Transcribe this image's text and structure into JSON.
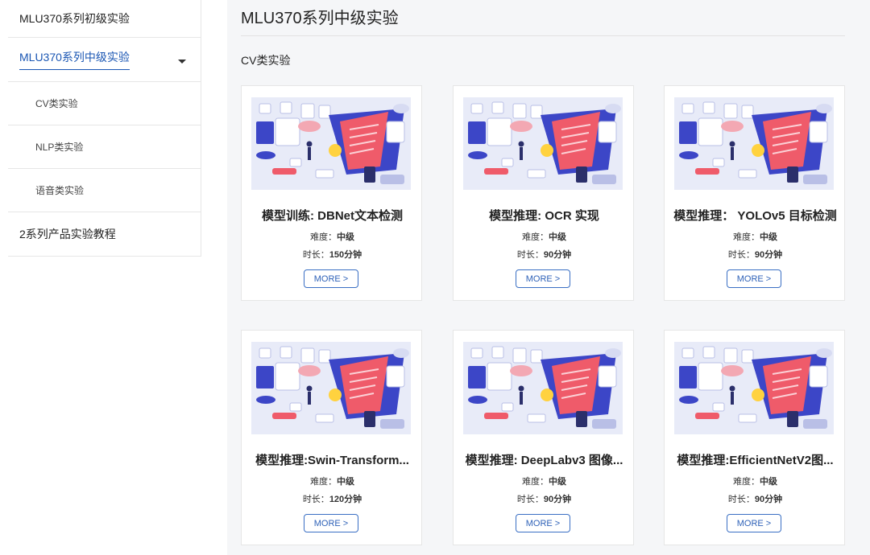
{
  "sidebar": {
    "items": [
      {
        "label": "MLU370系列初级实验"
      },
      {
        "label": "MLU370系列中级实验"
      },
      {
        "label": "2系列产品实验教程"
      }
    ],
    "sub_items": [
      {
        "label": "CV类实验"
      },
      {
        "label": "NLP类实验"
      },
      {
        "label": "语音类实验"
      }
    ]
  },
  "main": {
    "title": "MLU370系列中级实验",
    "section": "CV类实验",
    "difficulty_label": "难度：",
    "duration_label": "时长：",
    "more_label": "MORE >",
    "cards": [
      {
        "name": "模型训练: DBNet文本检测",
        "difficulty": "中级",
        "duration": "150分钟"
      },
      {
        "name": "模型推理: OCR 实现",
        "difficulty": "中级",
        "duration": "90分钟"
      },
      {
        "name": "模型推理： YOLOv5 目标检测",
        "difficulty": "中级",
        "duration": "90分钟"
      },
      {
        "name": "模型推理:Swin-Transform...",
        "difficulty": "中级",
        "duration": "120分钟"
      },
      {
        "name": "模型推理: DeepLabv3 图像...",
        "difficulty": "中级",
        "duration": "90分钟"
      },
      {
        "name": "模型推理:EfficientNetV2图...",
        "difficulty": "中级",
        "duration": "90分钟"
      }
    ]
  },
  "colors": {
    "accent": "#1a56b3",
    "illustration_bg": "#e6e9f7",
    "illustration_red": "#ef5b6a",
    "illustration_blue": "#3c46c7"
  }
}
